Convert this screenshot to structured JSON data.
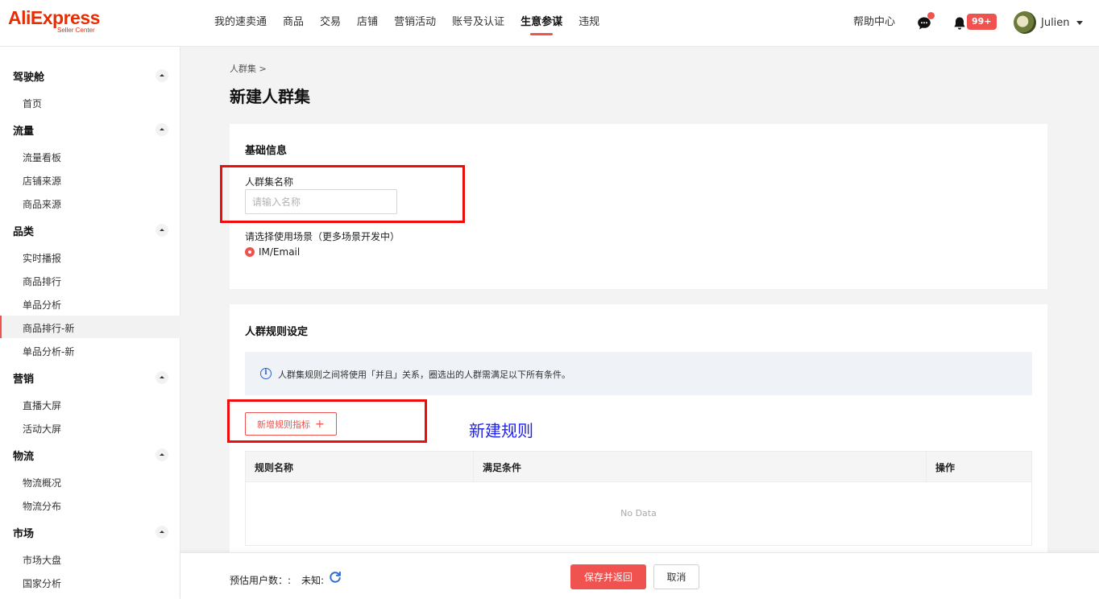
{
  "header": {
    "logo": {
      "main": "AliExpress",
      "sub": "Seller Center"
    },
    "nav": [
      "我的速卖通",
      "商品",
      "交易",
      "店铺",
      "营销活动",
      "账号及认证",
      "生意参谋",
      "违规"
    ],
    "nav_active_index": 6,
    "help": "帮助中心",
    "chat_icon": "chat-bubble-icon",
    "bell_icon": "bell-icon",
    "notification_badge": "99+",
    "user": {
      "name": "Julien",
      "avatar_icon": "user-avatar"
    }
  },
  "sidebar": {
    "sections": [
      {
        "title": "驾驶舱",
        "items": [
          "首页"
        ]
      },
      {
        "title": "流量",
        "items": [
          "流量看板",
          "店铺来源",
          "商品来源"
        ]
      },
      {
        "title": "品类",
        "items": [
          "实时播报",
          "商品排行",
          "单品分析",
          "商品排行-新",
          "单品分析-新"
        ]
      },
      {
        "title": "营销",
        "items": [
          "直播大屏",
          "活动大屏"
        ]
      },
      {
        "title": "物流",
        "items": [
          "物流概况",
          "物流分布"
        ]
      },
      {
        "title": "市场",
        "items": [
          "市场大盘",
          "国家分析"
        ]
      }
    ],
    "active_item": "商品排行-新",
    "toggle_icon": "collapse-arrow-icon"
  },
  "main": {
    "breadcrumb": "人群集  >",
    "title": "新建人群集",
    "basic_info": {
      "title": "基础信息",
      "name_label": "人群集名称",
      "name_placeholder": "请输入名称",
      "name_value": "",
      "scene_label": "请选择使用场景（更多场景开发中）",
      "scene_option": "IM/Email",
      "scene_selected": true
    },
    "rules": {
      "title": "人群规则设定",
      "info_icon": "info-icon",
      "info_text": "人群集规则之间将使用「并且」关系，圈选出的人群需满足以下所有条件。",
      "add_button": "新增规则指标",
      "add_button_icon": "+",
      "annotation": "新建规则",
      "table": {
        "columns": [
          "规则名称",
          "满足条件",
          "操作"
        ],
        "rows": [],
        "empty_text": "No Data"
      }
    }
  },
  "footer": {
    "estimate_label": "预估用户数：:",
    "estimate_value": "未知:",
    "refresh_icon": "refresh-icon",
    "save_button": "保存并返回",
    "cancel_button": "取消"
  },
  "colors": {
    "brand": "#e62e04",
    "accent": "#f0524f",
    "highlight_box": "#ee0c0c",
    "annotation": "#2222ee",
    "info_bar_bg": "#eff2f7",
    "info_icon": "#2d5fc8"
  }
}
